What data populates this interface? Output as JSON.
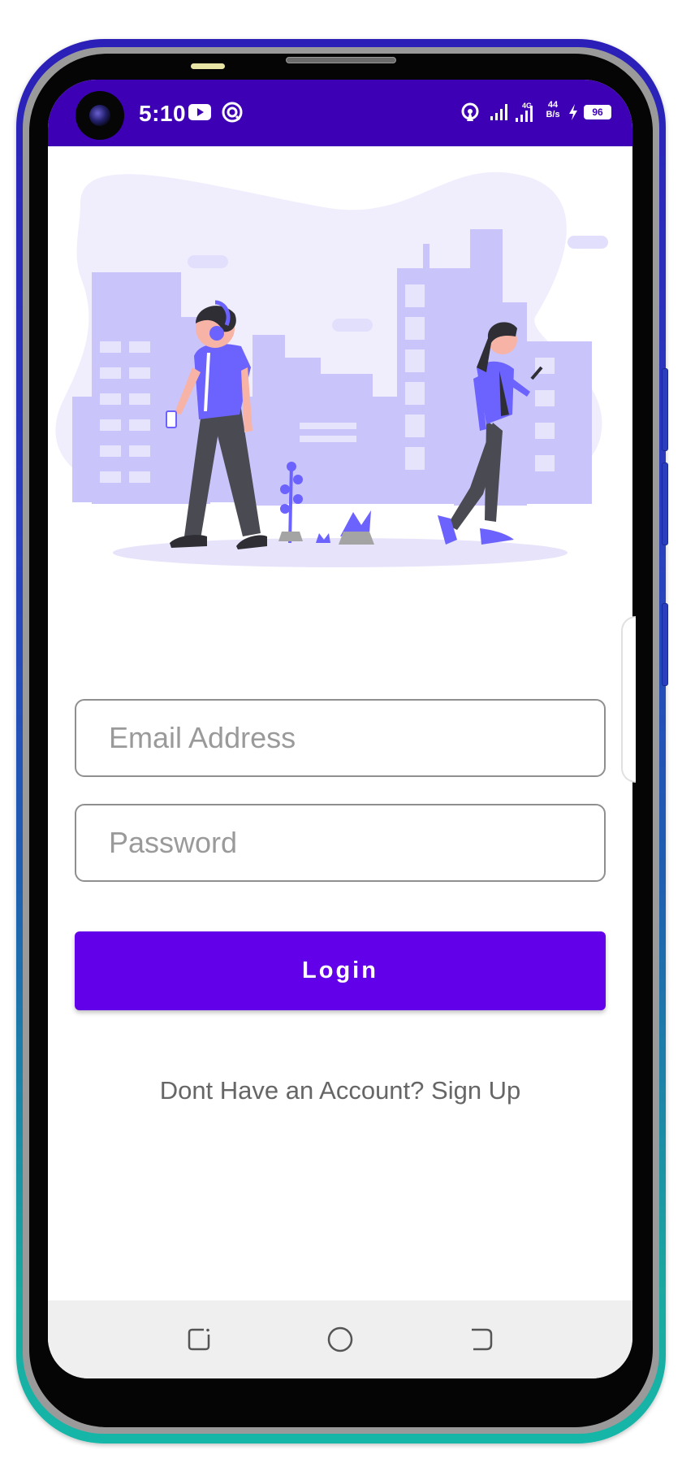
{
  "status_bar": {
    "time": "5:10",
    "net_speed_value": "44",
    "net_speed_unit": "B/s",
    "signal_tag": "4G",
    "battery_level": "96",
    "background_color": "#3d00b5"
  },
  "login_form": {
    "email_placeholder": "Email Address",
    "password_placeholder": "Password",
    "login_label": "Login",
    "signup_prompt": "Dont Have an Account? Sign Up",
    "accent_color": "#6200ea"
  },
  "icons": {
    "status": [
      "front-camera-icon",
      "youtube-icon",
      "app-notification-icon",
      "hotspot-icon",
      "signal-icon",
      "signal-4g-icon",
      "charging-icon",
      "battery-icon"
    ],
    "navigation": [
      "recent-apps-icon",
      "home-icon",
      "back-icon"
    ]
  },
  "illustration": {
    "subject": "two people walking with phones in front of city skyline"
  }
}
